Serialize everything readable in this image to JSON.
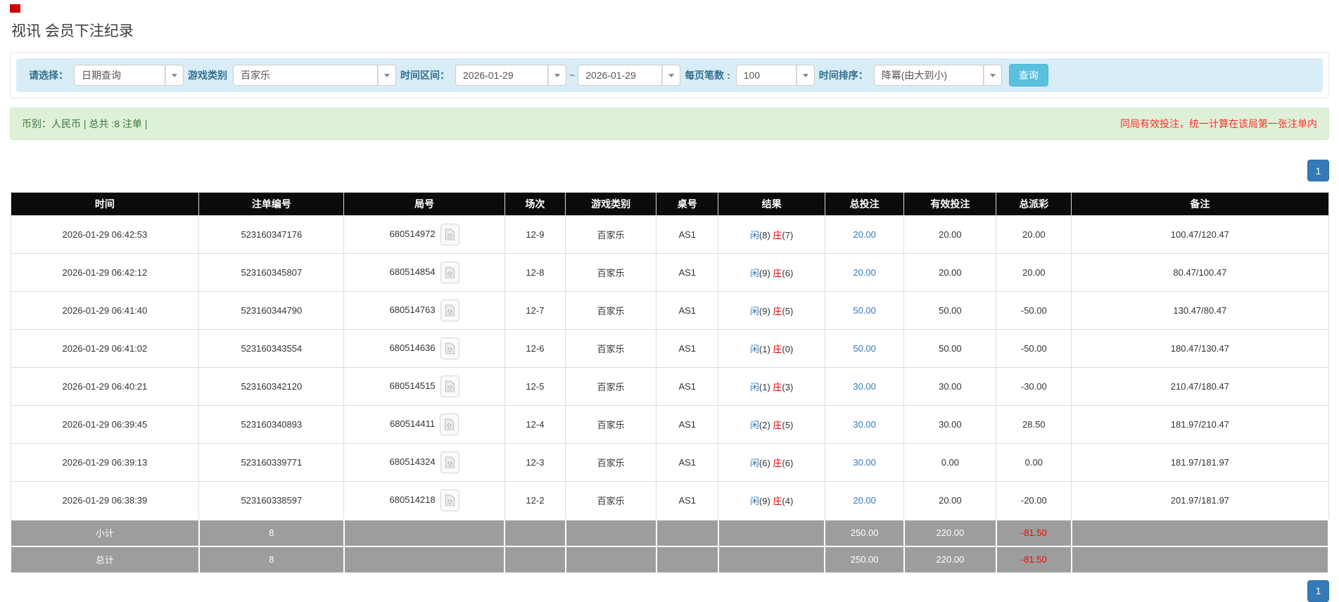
{
  "page": {
    "title": "视讯 会员下注纪录"
  },
  "colors": {
    "logo_red": "#cc0000",
    "filter_bar_bg": "#d9edf7",
    "label_blue": "#31708f",
    "search_button_bg": "#5bc0de",
    "alert_green_bg": "#dff0d8",
    "alert_text_green": "#3c763d",
    "notice_red": "#ff2d2d",
    "header_black": "#0b0b0b",
    "subtotal_gray": "#9d9d9d",
    "link_blue": "#337ab7",
    "banker_red": "#e60000",
    "negative_red": "#ff0000"
  },
  "filters": {
    "select_label": "请选择：",
    "select_value": "日期查询",
    "game_label": "游戏类别",
    "game_value": "百家乐",
    "range_label": "时间区间：",
    "date_from": "2026-01-29",
    "range_sep": "~",
    "date_to": "2026-01-29",
    "page_size_label": "每页笔数 :",
    "page_size_value": "100",
    "sort_label": "时间排序：",
    "sort_value": "降冪(由大到小)",
    "search_button": "查询"
  },
  "summary": {
    "left_text": "币别：人民币 | 总共 :8 注单 |",
    "right_text": "同局有效投注，统一计算在该局第一张注单内"
  },
  "pagination": {
    "page": "1"
  },
  "table": {
    "headers": [
      "时间",
      "注单编号",
      "局号",
      "场次",
      "游戏类别",
      "桌号",
      "结果",
      "总投注",
      "有效投注",
      "总派彩",
      "备注"
    ],
    "rows": [
      {
        "time": "2026-01-29 06:42:53",
        "bet_no": "523160347176",
        "round_no": "680514972",
        "session": "12-9",
        "game": "百家乐",
        "table_no": "AS1",
        "player": "闲",
        "player_score": "(8)",
        "banker": "庄",
        "banker_score": "(7)",
        "total_bet": "20.00",
        "valid_bet": "20.00",
        "payout": "20.00",
        "remark": "100.47/120.47"
      },
      {
        "time": "2026-01-29 06:42:12",
        "bet_no": "523160345807",
        "round_no": "680514854",
        "session": "12-8",
        "game": "百家乐",
        "table_no": "AS1",
        "player": "闲",
        "player_score": "(9)",
        "banker": "庄",
        "banker_score": "(6)",
        "total_bet": "20.00",
        "valid_bet": "20.00",
        "payout": "20.00",
        "remark": "80.47/100.47"
      },
      {
        "time": "2026-01-29 06:41:40",
        "bet_no": "523160344790",
        "round_no": "680514763",
        "session": "12-7",
        "game": "百家乐",
        "table_no": "AS1",
        "player": "闲",
        "player_score": "(9)",
        "banker": "庄",
        "banker_score": "(5)",
        "total_bet": "50.00",
        "valid_bet": "50.00",
        "payout": "-50.00",
        "remark": "130.47/80.47"
      },
      {
        "time": "2026-01-29 06:41:02",
        "bet_no": "523160343554",
        "round_no": "680514636",
        "session": "12-6",
        "game": "百家乐",
        "table_no": "AS1",
        "player": "闲",
        "player_score": "(1)",
        "banker": "庄",
        "banker_score": "(0)",
        "total_bet": "50.00",
        "valid_bet": "50.00",
        "payout": "-50.00",
        "remark": "180.47/130.47"
      },
      {
        "time": "2026-01-29 06:40:21",
        "bet_no": "523160342120",
        "round_no": "680514515",
        "session": "12-5",
        "game": "百家乐",
        "table_no": "AS1",
        "player": "闲",
        "player_score": "(1)",
        "banker": "庄",
        "banker_score": "(3)",
        "total_bet": "30.00",
        "valid_bet": "30.00",
        "payout": "-30.00",
        "remark": "210.47/180.47"
      },
      {
        "time": "2026-01-29 06:39:45",
        "bet_no": "523160340893",
        "round_no": "680514411",
        "session": "12-4",
        "game": "百家乐",
        "table_no": "AS1",
        "player": "闲",
        "player_score": "(2)",
        "banker": "庄",
        "banker_score": "(5)",
        "total_bet": "30.00",
        "valid_bet": "30.00",
        "payout": "28.50",
        "remark": "181.97/210.47"
      },
      {
        "time": "2026-01-29 06:39:13",
        "bet_no": "523160339771",
        "round_no": "680514324",
        "session": "12-3",
        "game": "百家乐",
        "table_no": "AS1",
        "player": "闲",
        "player_score": "(6)",
        "banker": "庄",
        "banker_score": "(6)",
        "total_bet": "30.00",
        "valid_bet": "0.00",
        "payout": "0.00",
        "remark": "181.97/181.97"
      },
      {
        "time": "2026-01-29 06:38:39",
        "bet_no": "523160338597",
        "round_no": "680514218",
        "session": "12-2",
        "game": "百家乐",
        "table_no": "AS1",
        "player": "闲",
        "player_score": "(9)",
        "banker": "庄",
        "banker_score": "(4)",
        "total_bet": "20.00",
        "valid_bet": "20.00",
        "payout": "-20.00",
        "remark": "201.97/181.97"
      }
    ],
    "subtotal": {
      "label": "小计",
      "count": "8",
      "total_bet": "250.00",
      "valid_bet": "220.00",
      "payout": "-81.50"
    },
    "total": {
      "label": "总计",
      "count": "8",
      "total_bet": "250.00",
      "valid_bet": "220.00",
      "payout": "-81.50"
    }
  }
}
